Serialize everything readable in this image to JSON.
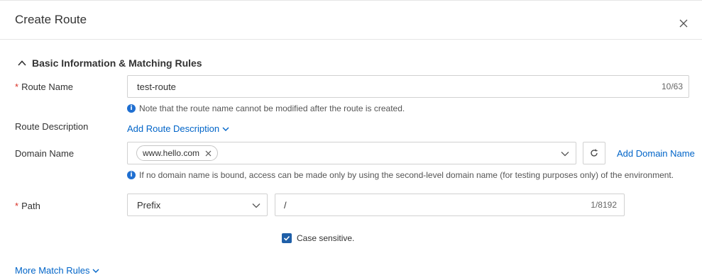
{
  "dialog": {
    "title": "Create Route",
    "close_icon": "close-icon"
  },
  "section": {
    "title": "Basic Information & Matching Rules",
    "toggle_icon": "chevron-up-icon"
  },
  "route_name": {
    "label": "Route Name",
    "required_mark": "*",
    "value": "test-route",
    "counter": "10/63",
    "hint": "Note that the route name cannot be modified after the route is created."
  },
  "route_description": {
    "label": "Route Description",
    "link": "Add Route Description"
  },
  "domain_name": {
    "label": "Domain Name",
    "tags": [
      "www.hello.com"
    ],
    "add_link": "Add Domain Name",
    "hint": "If no domain name is bound, access can be made only by using the second-level domain name (for testing purposes only) of the environment."
  },
  "path": {
    "label": "Path",
    "required_mark": "*",
    "match_type": "Prefix",
    "value": "/",
    "counter": "1/8192"
  },
  "case_sensitive": {
    "label": "Case sensitive.",
    "checked": true
  },
  "more_rules": {
    "link": "More Match Rules"
  },
  "colors": {
    "link": "#0064c8",
    "required": "#d93026",
    "checkbox": "#1f5fa8",
    "info": "#1f6fd1"
  }
}
